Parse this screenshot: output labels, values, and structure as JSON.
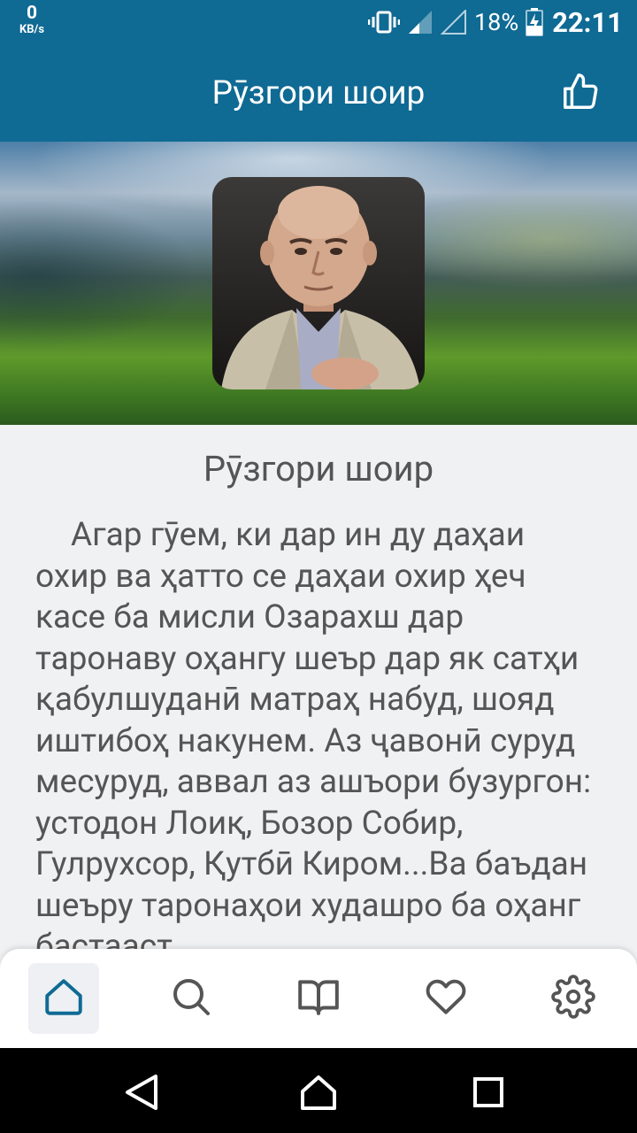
{
  "status_bar": {
    "net_speed_value": "0",
    "net_speed_unit": "KB/s",
    "battery_percent": "18%",
    "time": "22:11",
    "icons": [
      "vibrate-icon",
      "signal-icon",
      "signal-empty-icon",
      "battery-charging-icon"
    ]
  },
  "app_bar": {
    "title": "Рӯзгори шоир",
    "action_icon": "thumbs-up-icon"
  },
  "hero": {
    "portrait_icon": "author-portrait"
  },
  "content": {
    "title": "Рӯзгори шоир",
    "body": "Агар гӯем, ки дар ин ду даҳаи охир ва ҳатто се даҳаи охир ҳеч касе ба мисли Озарахш дар таронаву оҳангу шеър дар як сатҳи қабулшуданӣ матраҳ набуд, шояд иштибоҳ накунем. Аз ҷавонӣ суруд месуруд, аввал аз ашъори бузургон: устодон Лоиқ, Бозор Собир, Гулрухсор, Қутбӣ Киром...Ва баъдан шеъру таронаҳои худашро ба оҳанг бастааст."
  },
  "bottom_nav": {
    "items": [
      {
        "icon": "home-icon",
        "active": true
      },
      {
        "icon": "search-icon",
        "active": false
      },
      {
        "icon": "book-icon",
        "active": false
      },
      {
        "icon": "heart-icon",
        "active": false
      },
      {
        "icon": "gear-icon",
        "active": false
      }
    ]
  },
  "system_nav": {
    "items": [
      "back-icon",
      "home-outline-icon",
      "recents-icon"
    ]
  },
  "colors": {
    "primary": "#0f6a94",
    "text": "#555555",
    "background": "#f0f1f3",
    "nav_active_icon": "#0f6a94",
    "nav_icon": "#555555"
  }
}
